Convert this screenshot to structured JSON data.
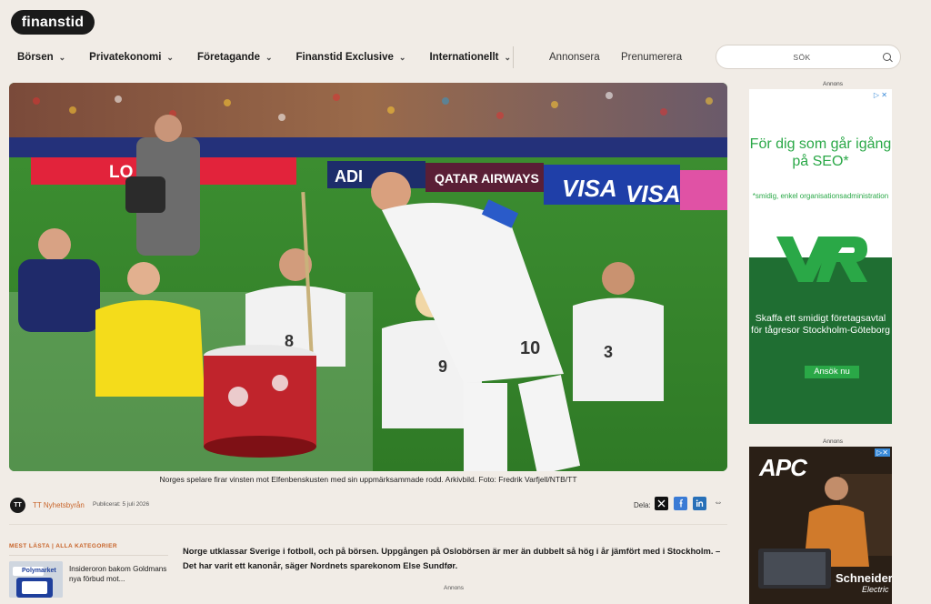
{
  "brand": {
    "logo": "finanstid"
  },
  "nav": {
    "items": [
      {
        "label": "Börsen"
      },
      {
        "label": "Privatekonomi"
      },
      {
        "label": "Företagande"
      },
      {
        "label": "Finanstid Exclusive"
      },
      {
        "label": "Internationellt"
      }
    ],
    "advertise": "Annonsera",
    "subscribe": "Prenumerera"
  },
  "search": {
    "placeholder": "SÖK"
  },
  "article": {
    "image_caption": "Norges spelare firar vinsten mot Elfenbenskusten med sin uppmärksammade rodd. Arkivbild. Foto: Fredrik Varfjell/NTB/TT",
    "author_initials": "TT",
    "author": "TT Nyhetsbyrån",
    "published": "Publicerat: 5 juli 2026",
    "share_label": "Dela:",
    "lede": "Norge utklassar Sverige i fotboll, och på börsen. Uppgången på Oslobörsen är mer än dubbelt så hög i år jämfört med i Stockholm. – Det har varit ett kanonår, säger Nordnets sparekonom Else Sundfør."
  },
  "hero_image": {
    "banners": [
      "LO",
      "ADI",
      "QATAR AIRWAYS",
      "VISA",
      "VISA"
    ],
    "shirt_numbers": [
      "8",
      "10",
      "9",
      "3"
    ]
  },
  "most_read": {
    "header": "MEST LÄSTA | ALLA KATEGORIER",
    "items": [
      {
        "thumb_label": "Polymarket",
        "title": "Insideroron bakom Goldmans nya förbud mot..."
      }
    ]
  },
  "ads": {
    "label": "Annons",
    "vr": {
      "headline": "För dig som går igång på SEO*",
      "footnote": "*smidig, enkel organisationsadministration",
      "logo": "VR",
      "body": "Skaffa ett smidigt företagsavtal för tågresor Stockholm-Göteborg",
      "cta": "Ansök nu",
      "choices_icon": "ad-choices-icon"
    },
    "apc": {
      "logo": "APC",
      "brand_line1": "Schneider",
      "brand_line2": "Electric"
    }
  },
  "colors": {
    "background": "#f1ece6",
    "accent_orange": "#c8642a",
    "vr_green": "#2aa847",
    "vr_dark_green": "#1f6e32"
  }
}
